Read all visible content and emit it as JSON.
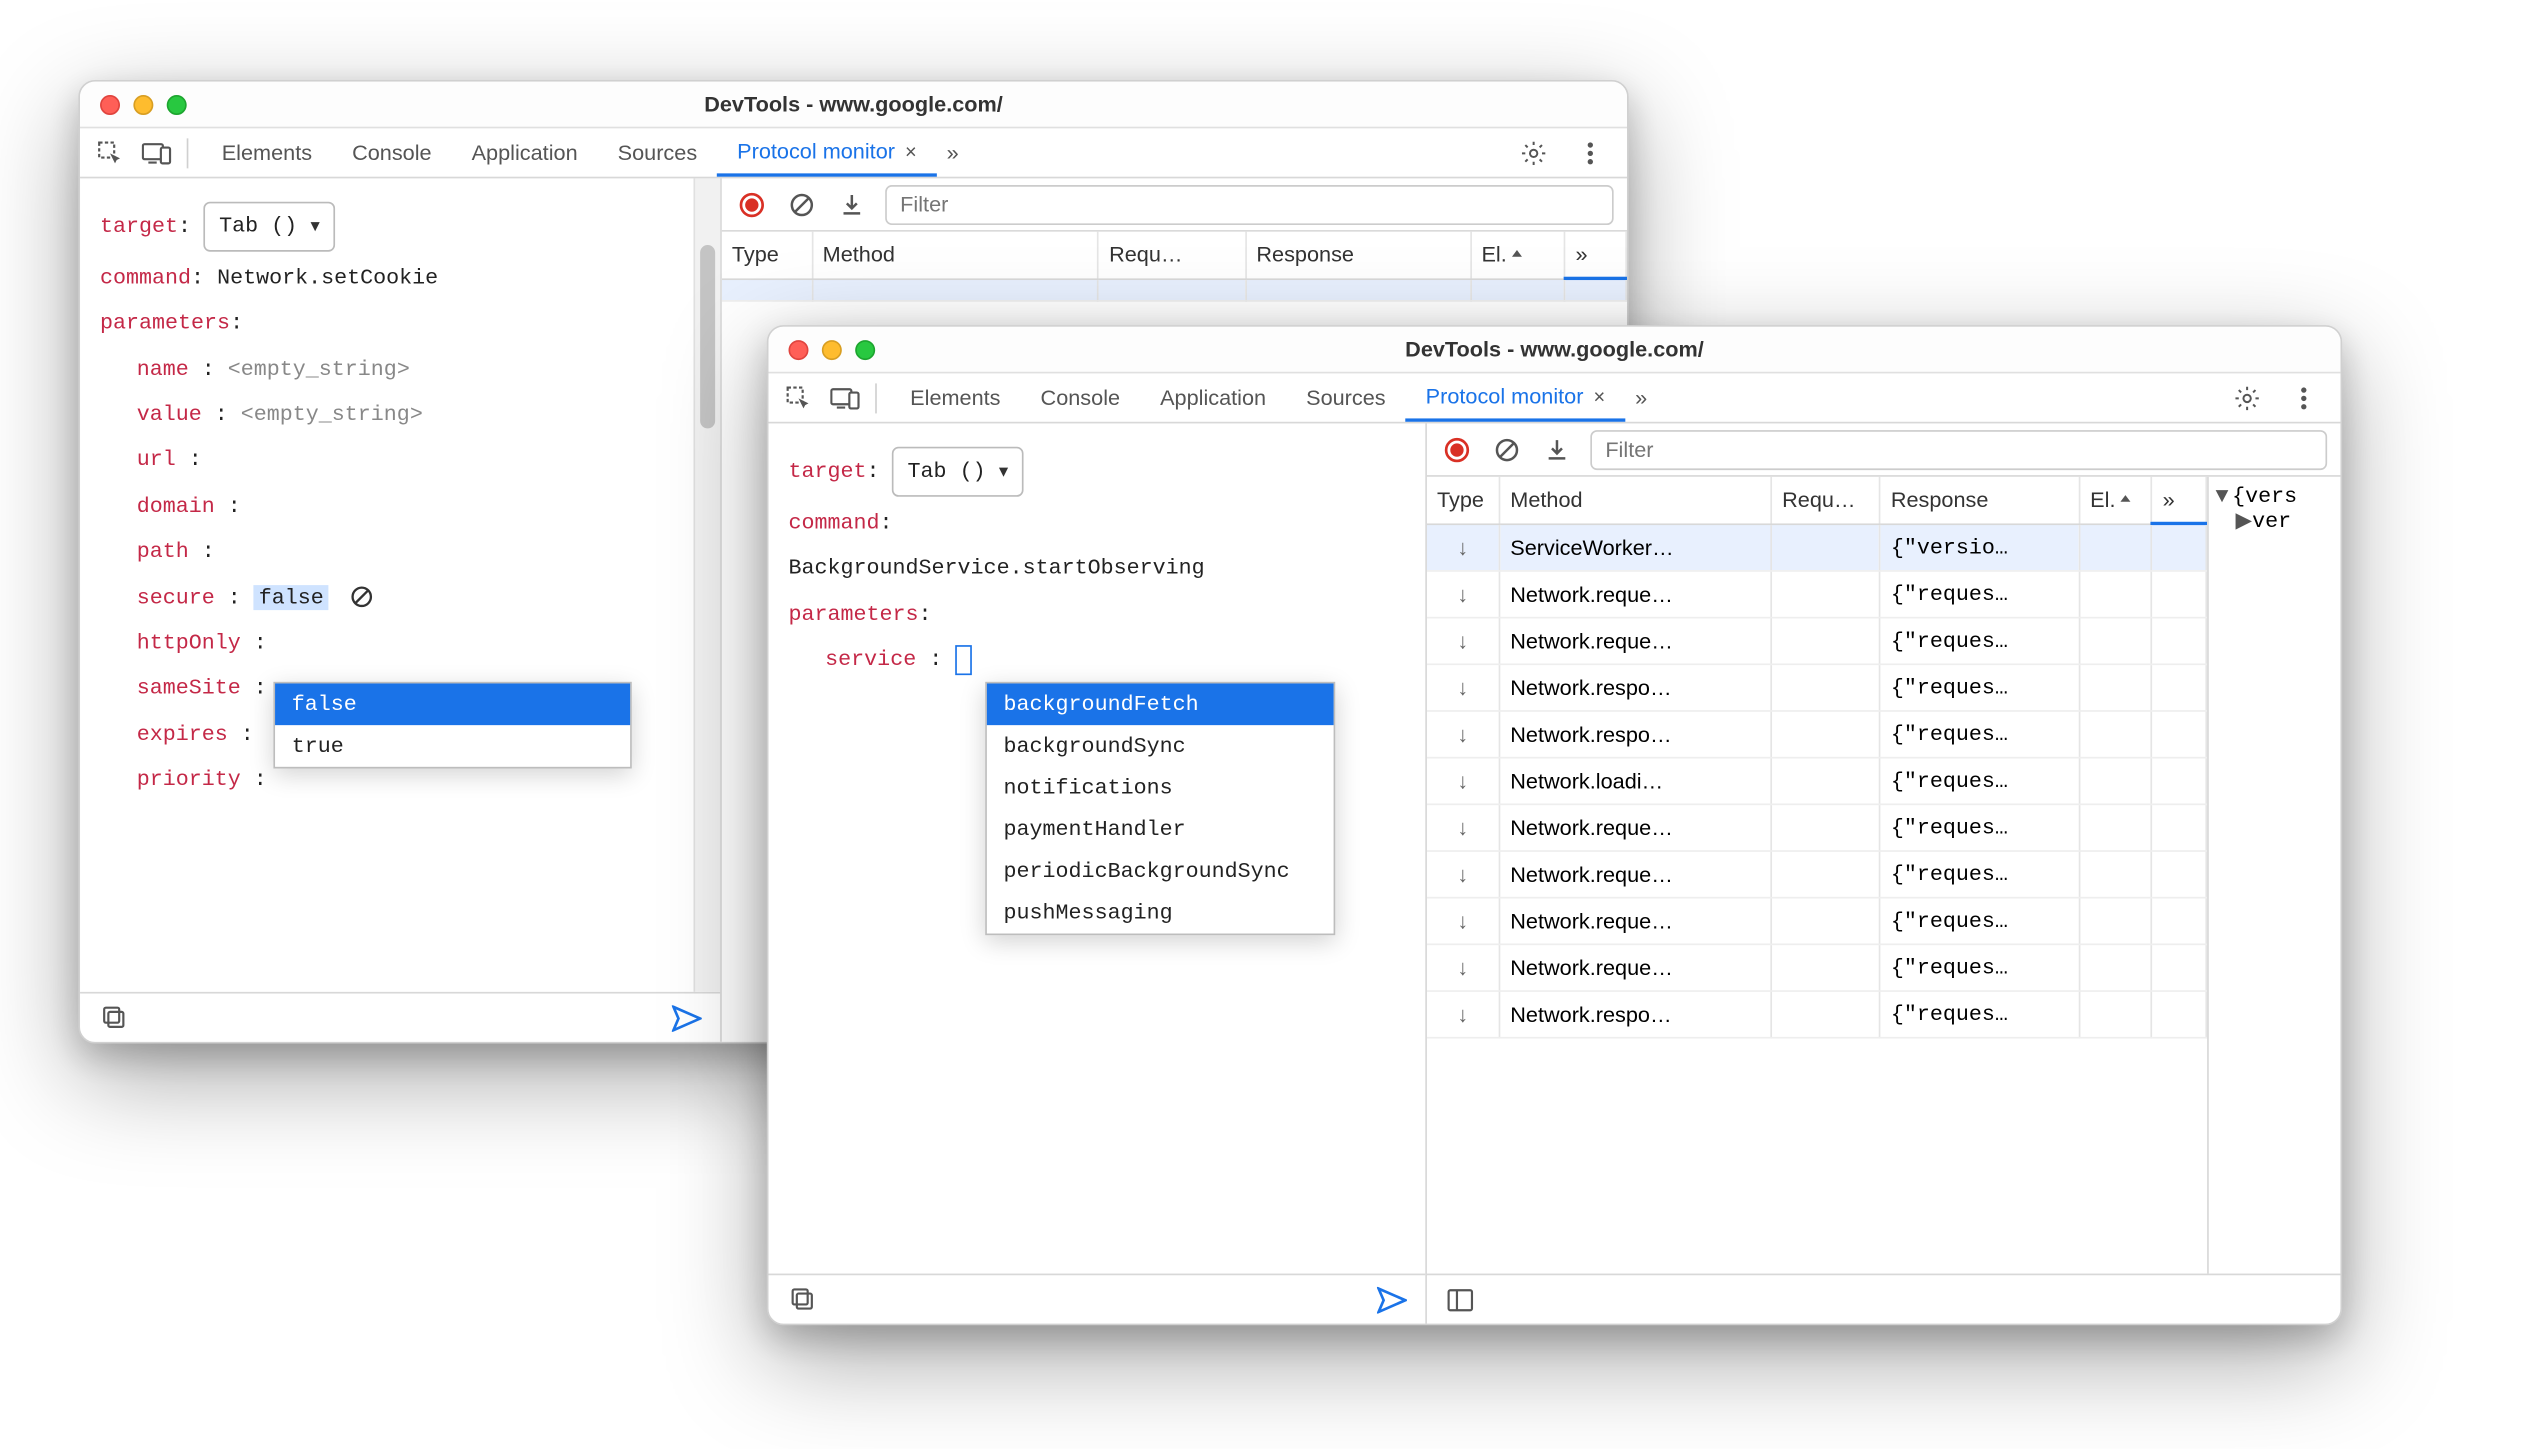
{
  "windows": {
    "w1": {
      "title": "DevTools - www.google.com/",
      "tabs": [
        "Elements",
        "Console",
        "Application",
        "Sources",
        "Protocol monitor"
      ],
      "activeTab": "Protocol monitor",
      "left": {
        "targetLabel": "target",
        "targetValue": "Tab ()",
        "commandLabel": "command",
        "commandValue": "Network.setCookie",
        "parametersLabel": "parameters",
        "params": [
          {
            "key": "name",
            "value": "<empty_string>",
            "muted": true
          },
          {
            "key": "value",
            "value": "<empty_string>",
            "muted": true
          },
          {
            "key": "url",
            "value": ""
          },
          {
            "key": "domain",
            "value": ""
          },
          {
            "key": "path",
            "value": ""
          },
          {
            "key": "secure",
            "value": "false",
            "editing": true
          },
          {
            "key": "httpOnly",
            "value": ""
          },
          {
            "key": "sameSite",
            "value": ""
          },
          {
            "key": "expires",
            "value": ""
          },
          {
            "key": "priority",
            "value": ""
          }
        ],
        "autocompleteOptions": [
          "false",
          "true"
        ],
        "autocompleteSelected": 0
      },
      "right": {
        "filterPlaceholder": "Filter",
        "columns": [
          "Type",
          "Method",
          "Requ…",
          "Response",
          "El."
        ],
        "rows": []
      }
    },
    "w2": {
      "title": "DevTools - www.google.com/",
      "tabs": [
        "Elements",
        "Console",
        "Application",
        "Sources",
        "Protocol monitor"
      ],
      "activeTab": "Protocol monitor",
      "left": {
        "targetLabel": "target",
        "targetValue": "Tab ()",
        "commandLabel": "command",
        "commandValue": "BackgroundService.startObserving",
        "parametersLabel": "parameters",
        "params": [
          {
            "key": "service",
            "value": "",
            "editing": true
          }
        ],
        "autocompleteOptions": [
          "backgroundFetch",
          "backgroundSync",
          "notifications",
          "paymentHandler",
          "periodicBackgroundSync",
          "pushMessaging"
        ],
        "autocompleteSelected": 0
      },
      "right": {
        "filterPlaceholder": "Filter",
        "columns": [
          "Type",
          "Method",
          "Requ…",
          "Response",
          "El."
        ],
        "rows": [
          {
            "type": "↓",
            "method": "ServiceWorker…",
            "request": "",
            "response": "{\"versio…",
            "selected": true
          },
          {
            "type": "↓",
            "method": "Network.reque…",
            "request": "",
            "response": "{\"reques…"
          },
          {
            "type": "↓",
            "method": "Network.reque…",
            "request": "",
            "response": "{\"reques…"
          },
          {
            "type": "↓",
            "method": "Network.respo…",
            "request": "",
            "response": "{\"reques…"
          },
          {
            "type": "↓",
            "method": "Network.respo…",
            "request": "",
            "response": "{\"reques…"
          },
          {
            "type": "↓",
            "method": "Network.loadi…",
            "request": "",
            "response": "{\"reques…"
          },
          {
            "type": "↓",
            "method": "Network.reque…",
            "request": "",
            "response": "{\"reques…"
          },
          {
            "type": "↓",
            "method": "Network.reque…",
            "request": "",
            "response": "{\"reques…"
          },
          {
            "type": "↓",
            "method": "Network.reque…",
            "request": "",
            "response": "{\"reques…"
          },
          {
            "type": "↓",
            "method": "Network.reque…",
            "request": "",
            "response": "{\"reques…"
          },
          {
            "type": "↓",
            "method": "Network.respo…",
            "request": "",
            "response": "{\"reques…"
          }
        ],
        "detail": {
          "line1": "{vers",
          "line2": "ver"
        }
      }
    }
  },
  "icons": {
    "moreChevron": "»"
  }
}
